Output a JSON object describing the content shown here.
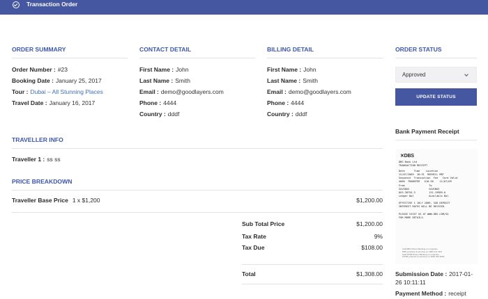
{
  "header": {
    "title": "Transaction Order"
  },
  "order_summary": {
    "title": "ORDER SUMMARY",
    "order_number_label": "Order Number :",
    "order_number": "#23",
    "booking_date_label": "Booking Date :",
    "booking_date": "January 25, 2017",
    "tour_label": "Tour :",
    "tour": "Dubai – All Stunning Places",
    "travel_date_label": "Travel Date :",
    "travel_date": "January 16, 2017"
  },
  "contact_detail": {
    "title": "CONTACT DETAIL",
    "first_name_label": "First Name :",
    "first_name": "John",
    "last_name_label": "Last Name :",
    "last_name": "Smith",
    "email_label": "Email :",
    "email": "demo@goodlayers.com",
    "phone_label": "Phone :",
    "phone": "4444",
    "country_label": "Country :",
    "country": "dddf"
  },
  "billing_detail": {
    "title": "BILLING DETAIL",
    "first_name_label": "First Name :",
    "first_name": "John",
    "last_name_label": "Last Name :",
    "last_name": "Smith",
    "email_label": "Email :",
    "email": "demo@goodlayers.com",
    "phone_label": "Phone :",
    "phone": "4444",
    "country_label": "Country :",
    "country": "dddf"
  },
  "order_status": {
    "title": "ORDER STATUS",
    "selected": "Approved",
    "button": "UPDATE STATUS"
  },
  "traveller_info": {
    "title": "TRAVELLER INFO",
    "traveller_label": "Traveller 1 :",
    "traveller_value": "ss ss"
  },
  "price_breakdown": {
    "title": "PRICE BREAKDOWN",
    "base_label": "Traveller Base Price",
    "base_qty": "1 x $1,200",
    "base_amount": "$1,200.00",
    "subtotal_label": "Sub Total Price",
    "subtotal": "$1,200.00",
    "tax_rate_label": "Tax Rate",
    "tax_rate": "9%",
    "tax_due_label": "Tax Due",
    "tax_due": "$108.00",
    "total_label": "Total",
    "total": "$1,308.00"
  },
  "payment": {
    "receipt_title": "Bank Payment Receipt",
    "submission_label": "Submission Date :",
    "submission_date": "2017-01-",
    "submission_time": "26 10:11:11",
    "method_label": "Payment Method :",
    "method": "receipt"
  },
  "receipt_image": {
    "logo": "✕DBS",
    "lines": [
      "DBS Bank Ltd",
      "TRANSACTION RECEIPT",
      "Date      Time    Location",
      "12/07/2009  18:31  REDHILL MRT",
      "Sequence  Transaction  Fee   Card Valid",
      "4060  TRANSFER   $10.30    11/07/09",
      "From                To",
      "SAVINGS             SAVINGS",
      "053-38754-3         131-19989-0",
      "Ledger Bal          Available Bal",
      "",
      "EFFECTIVE 1 JULY 2009, SGD DEPOSIT",
      "INTEREST RATES WILL BE REVISED.",
      "",
      "PLEASE VISIT US AT WWW.DBS.COM/SG",
      "FOR MORE DETAILS."
    ],
    "footer": [
      "Call DBS Phone Banking on enquiries",
      "DBS products & services on 1800 111 1111",
      "Call POSB Phone Banking on enquiries",
      "POSB products & services on 1800 339 6666"
    ]
  },
  "colors": {
    "accent": "#4557a0",
    "section_title": "#3e56a8",
    "link": "#3e6fb8"
  }
}
